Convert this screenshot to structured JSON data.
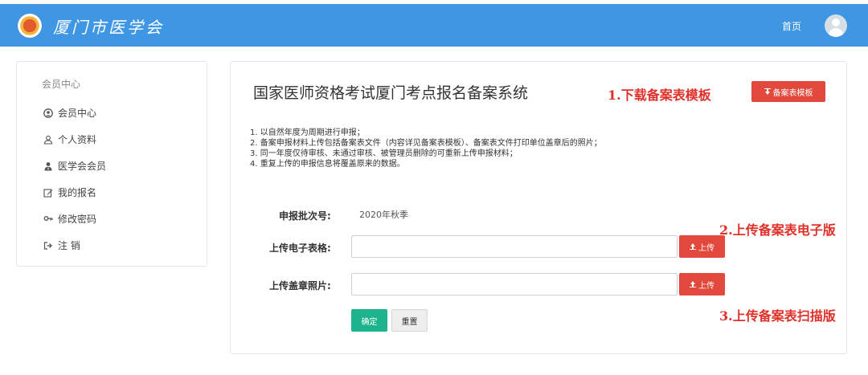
{
  "header": {
    "logo_text": "厦门市医学会",
    "nav_home": "首页",
    "background_color": "#3f96e3"
  },
  "sidebar": {
    "title": "会员中心",
    "items": [
      {
        "label": "会员中心",
        "icon": "user-circle-icon"
      },
      {
        "label": "个人资料",
        "icon": "user-icon"
      },
      {
        "label": "医学会会员",
        "icon": "user-tie-icon"
      },
      {
        "label": "我的报名",
        "icon": "edit-icon"
      },
      {
        "label": "修改密码",
        "icon": "key-icon"
      },
      {
        "label": "注 销",
        "icon": "sign-out-icon"
      }
    ]
  },
  "main": {
    "title": "国家医师资格考试厦门考点报名备案系统",
    "template_button": "备案表模板",
    "notes": [
      "1. 以自然年度为周期进行申报；",
      "2. 备案申报材料上传包括备案表文件（内容详见备案表模板）、备案表文件打印单位盖章后的照片；",
      "3. 同一年度仅待审核、未通过审核、被管理员删除的可重新上传申报材料；",
      "4. 重复上传的申报信息将覆盖原来的数据。"
    ],
    "form": {
      "batch_label": "申报批次号:",
      "batch_value": "2020年秋季",
      "excel_label": "上传电子表格:",
      "excel_value": "",
      "photo_label": "上传盖章照片:",
      "photo_value": "",
      "upload_label": "上传",
      "confirm_label": "确定",
      "reset_label": "重置"
    }
  },
  "annotations": {
    "step1": "1.下载备案表模板",
    "step2": "2.上传备案表电子版",
    "step3": "3.上传备案表扫描版"
  },
  "colors": {
    "accent_red": "#e2483b",
    "confirm_green": "#1db38c",
    "annotation_red": "#e0302a"
  }
}
